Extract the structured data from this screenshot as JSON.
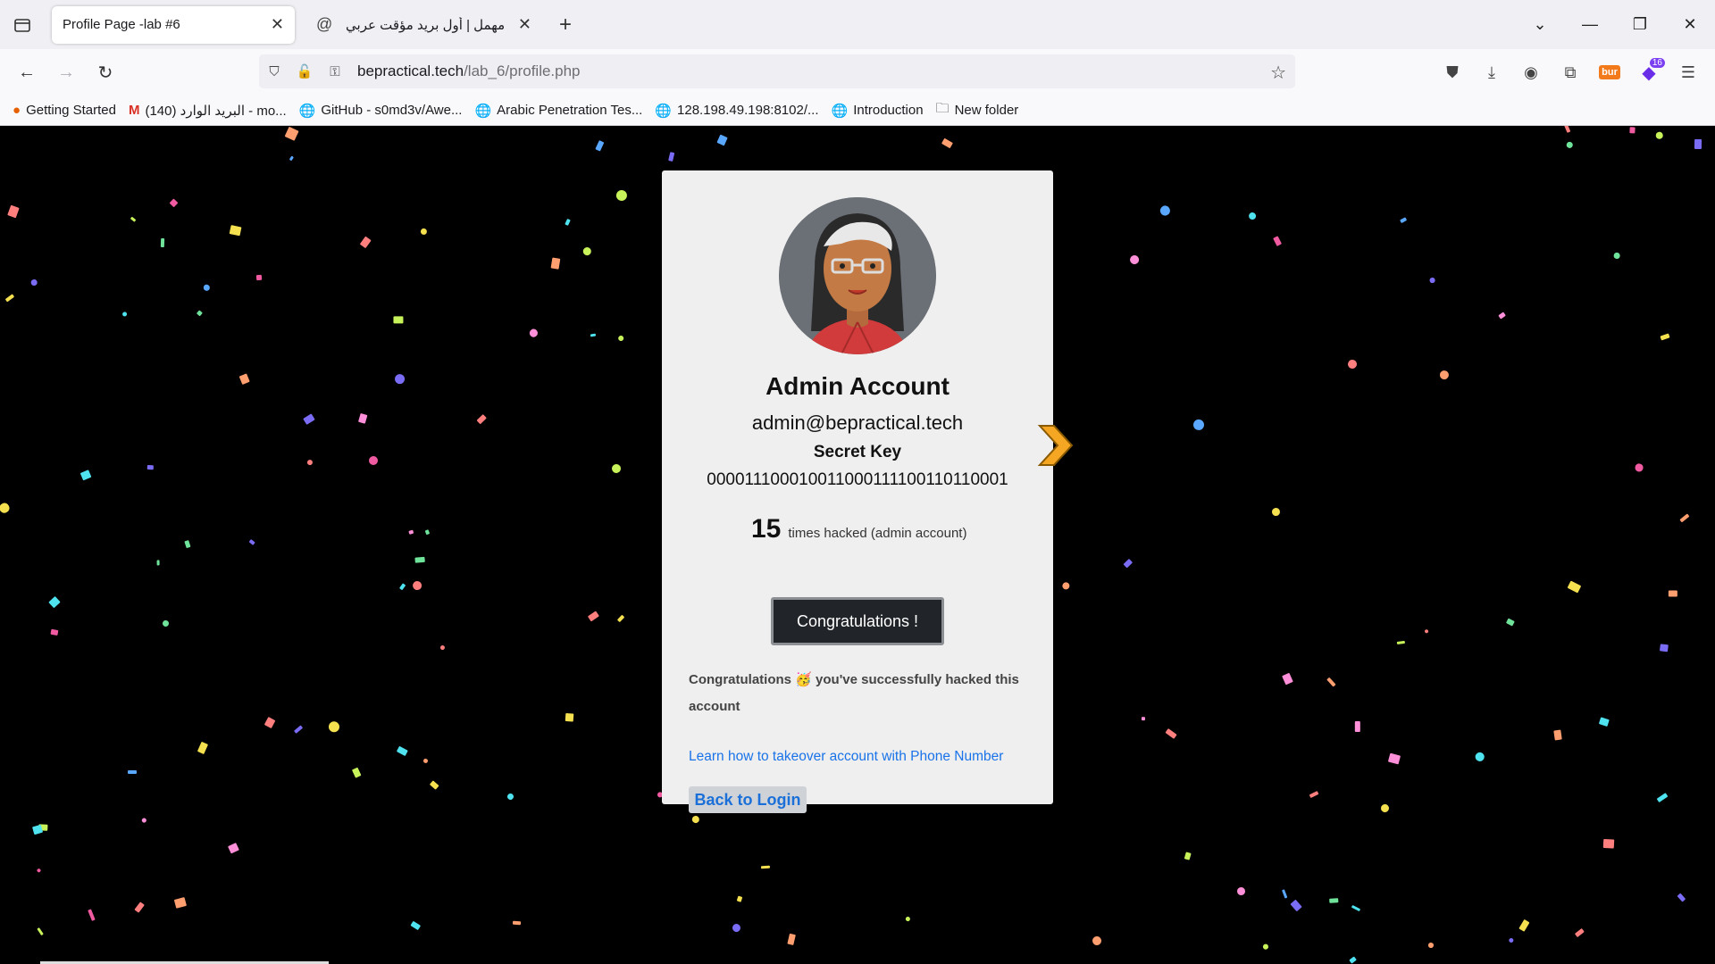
{
  "browser": {
    "tabs": [
      {
        "title": "Profile Page -lab #6",
        "active": true
      },
      {
        "title": "مهمل | أول بريد مؤقت عربي",
        "active": false
      }
    ],
    "url_domain": "bepractical.tech",
    "url_path": "/lab_6/profile.php",
    "extension_burp_label": "bur",
    "extension_badge": "16",
    "bookmarks": [
      {
        "label": "Getting Started",
        "icon": "firefox-icon"
      },
      {
        "label": "البريد الوارد (140) - mo...",
        "icon": "gmail-icon"
      },
      {
        "label": "GitHub - s0md3v/Awe...",
        "icon": "globe-icon"
      },
      {
        "label": "Arabic Penetration Tes...",
        "icon": "globe-icon"
      },
      {
        "label": "128.198.49.198:8102/...",
        "icon": "globe-icon"
      },
      {
        "label": "Introduction",
        "icon": "globe-icon"
      },
      {
        "label": "New folder",
        "icon": "folder-icon"
      }
    ]
  },
  "profile": {
    "name": "Admin Account",
    "email": "admin@bepractical.tech",
    "secret_key_label": "Secret Key",
    "secret_key_value": "0000111000100110001111001101​10001",
    "hack_count": "15",
    "hack_text": "times hacked (admin account)",
    "congrats_button": "Congratulations !",
    "congrats_message_part1": "Congratulations",
    "congrats_emoji": "🥳",
    "congrats_message_part2": " you've successfully hacked this account",
    "learn_link": "Learn how to takeover account with Phone Number",
    "back_button": "Back to Login"
  },
  "colors": {
    "page_background": "#000000",
    "card_background": "#efefef",
    "button_dark": "#212529",
    "link": "#1a73e8",
    "arrow": "#f5a623"
  }
}
